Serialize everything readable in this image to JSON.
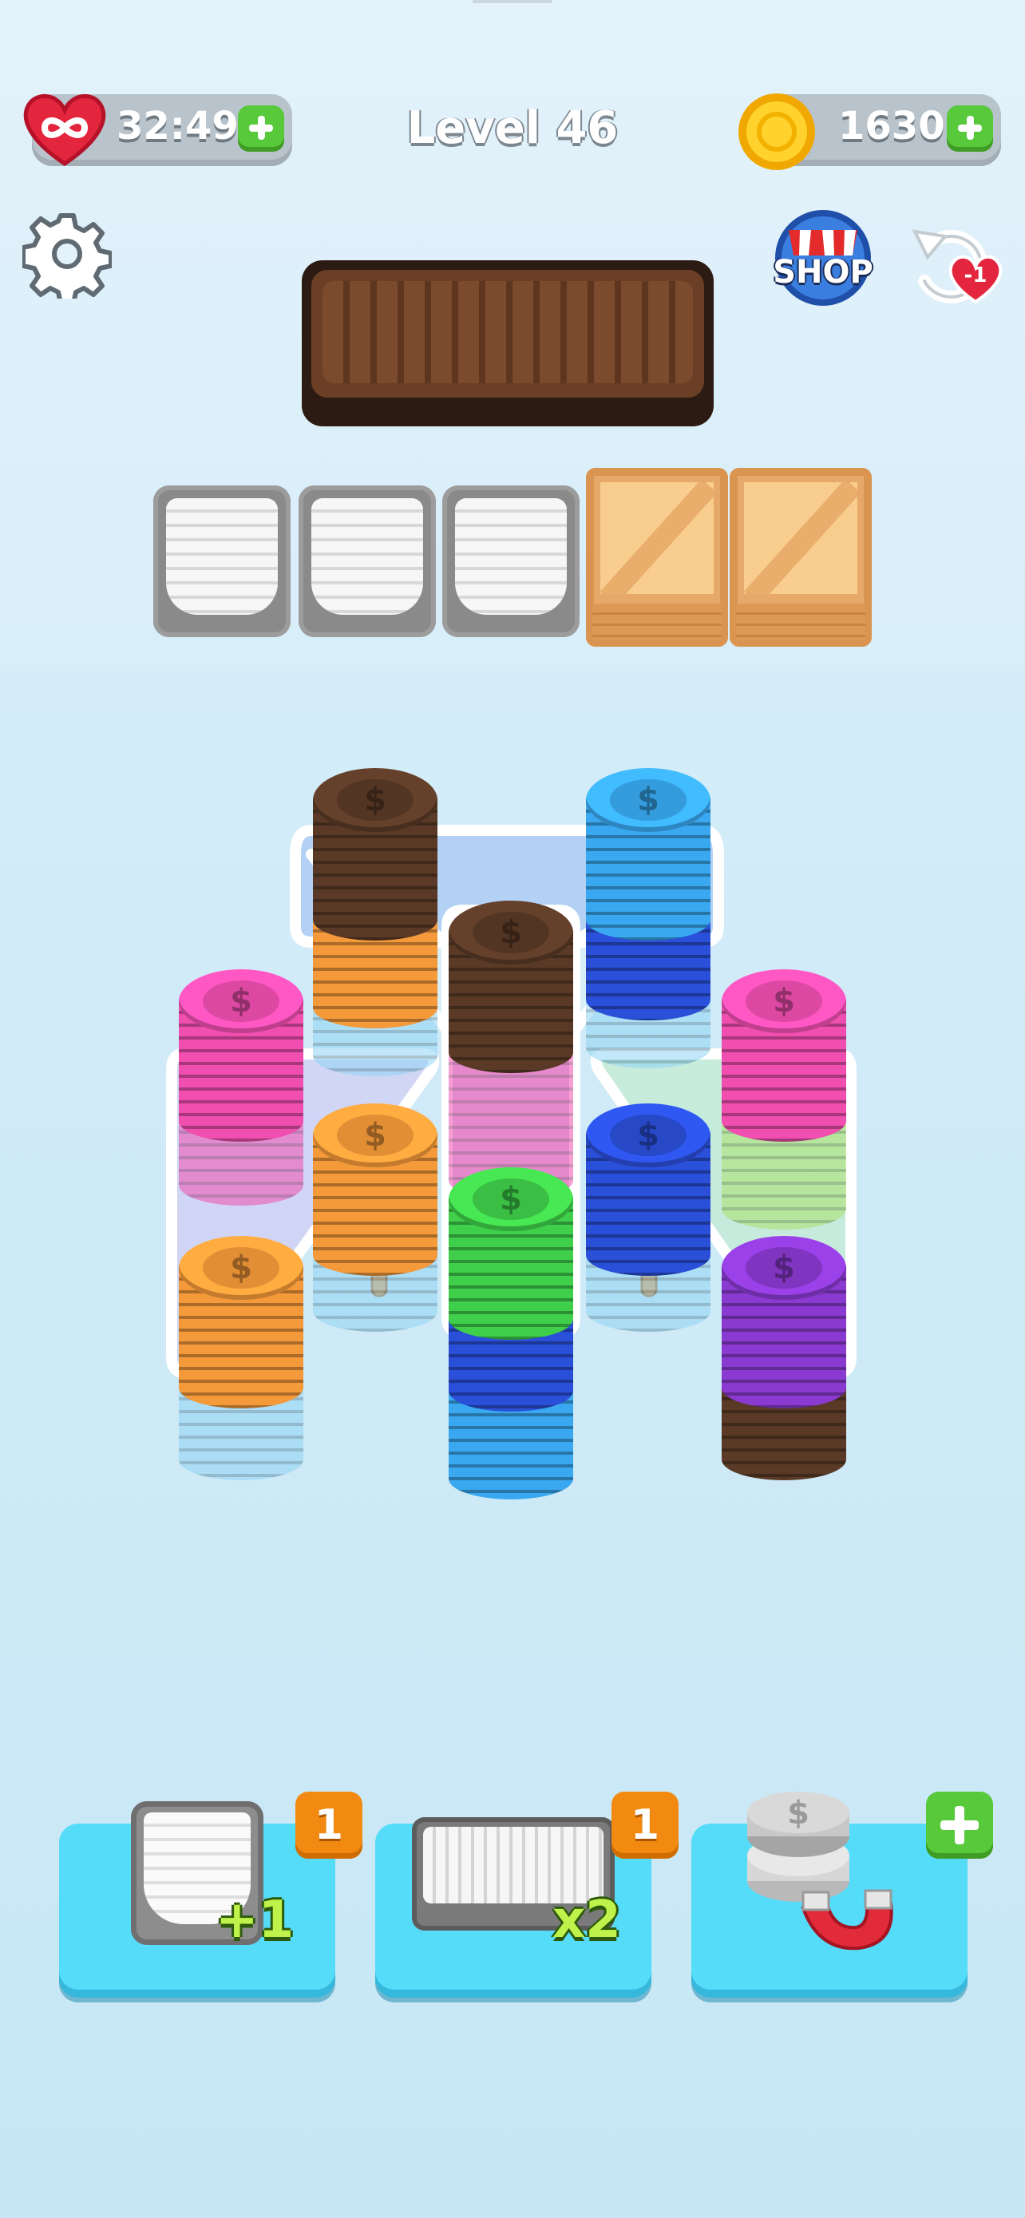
{
  "header": {
    "lives": {
      "icon": "infinity-heart-icon",
      "timer": "32:49"
    },
    "level": "Level 46",
    "coins": {
      "icon": "gold-coin-icon",
      "amount": "1630"
    }
  },
  "toolbar": {
    "settings_icon": "gear-icon",
    "shop_label": "SHOP",
    "undo_badge": "-1"
  },
  "slots": [
    {
      "state": "open"
    },
    {
      "state": "open"
    },
    {
      "state": "open"
    },
    {
      "state": "locked-crate"
    },
    {
      "state": "locked-crate"
    }
  ],
  "coin_symbol": "$",
  "colors": {
    "brown": "#5a3a26",
    "blue": "#39a8f0",
    "pink": "#f04fb0",
    "orange": "#f59a3a",
    "green": "#3fcf4a",
    "navy": "#2a4fd8",
    "purple": "#8a3ad0",
    "lightblue": "#8fd3f4",
    "lime": "#a8e06a"
  },
  "boosters": [
    {
      "name": "extra-slot",
      "label": "+1",
      "count": "1"
    },
    {
      "name": "double-tray",
      "label": "x2",
      "count": "1"
    },
    {
      "name": "magnet",
      "count": "+"
    }
  ]
}
